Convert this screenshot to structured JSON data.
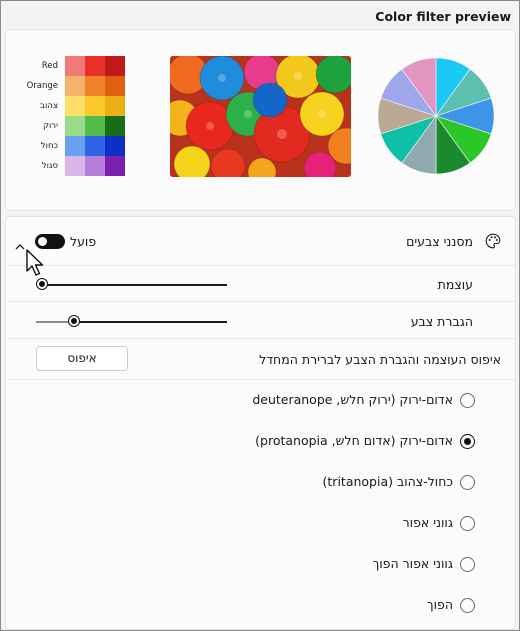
{
  "preview": {
    "title": "Color filter preview",
    "swatch_labels": [
      "Red",
      "Orange",
      "צהוב",
      "ירוק",
      "כחול",
      "סגול"
    ],
    "swatch_colors": [
      [
        "#f07a74",
        "#e8302a",
        "#c01a1a"
      ],
      [
        "#f5b36a",
        "#f0822a",
        "#e05f10"
      ],
      [
        "#fde06a",
        "#fbc82e",
        "#ecaf16"
      ],
      [
        "#99db88",
        "#52bd49",
        "#176e18"
      ],
      [
        "#6aa0ef",
        "#2e64e6",
        "#0c2fc6"
      ],
      [
        "#d8b5eb",
        "#b57ed9",
        "#7a22ad"
      ]
    ],
    "pie_colors": [
      "#1cc9f3",
      "#5dbfb0",
      "#3c95e8",
      "#2bc628",
      "#1b8a2e",
      "#90a9ae",
      "#0fbfa8",
      "#b9a894",
      "#9ea7eb",
      "#e195c1"
    ]
  },
  "filters": {
    "title": "מסנני צבעים",
    "toggle_label": "פועל",
    "toggle_on": true,
    "intensity_label": "עוצמת",
    "intensity_value": 0,
    "boost_label": "הגברת צבע",
    "boost_value": 0.2,
    "reset_text": "איפוס העוצמה והגברת הצבע לברירת המחדל",
    "reset_button": "איפוס",
    "options": [
      {
        "label": "אדום-ירוק (ירוק חלש, deuteranope",
        "selected": false
      },
      {
        "label": "אדום-ירוק (אדום חלש, protanopia)",
        "selected": true
      },
      {
        "label": "כחול-צהוב (tritanopia)",
        "selected": false
      },
      {
        "label": "גווני אפור",
        "selected": false
      },
      {
        "label": "גווני אפור הפוך",
        "selected": false
      },
      {
        "label": "הפוך",
        "selected": false
      }
    ]
  }
}
